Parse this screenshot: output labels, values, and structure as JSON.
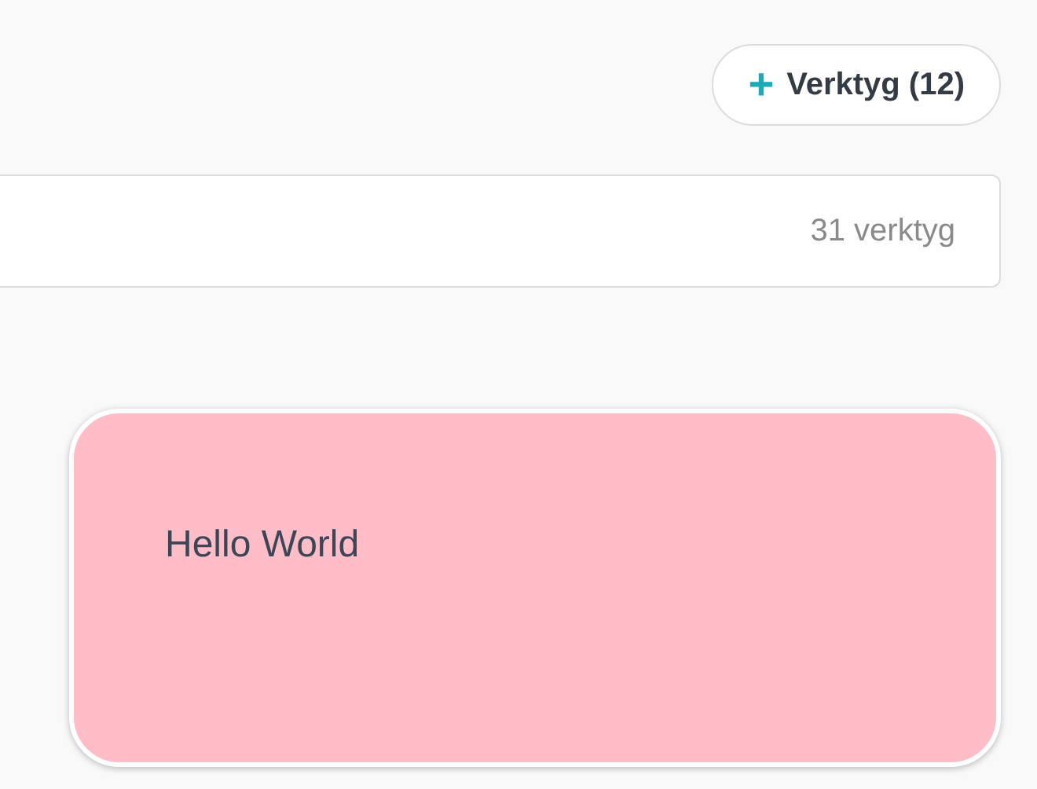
{
  "toolbar": {
    "add_button": {
      "icon": "+",
      "label": "Verktyg (12)"
    }
  },
  "search": {
    "count": "31 verktyg"
  },
  "card": {
    "text": "Hello World"
  }
}
